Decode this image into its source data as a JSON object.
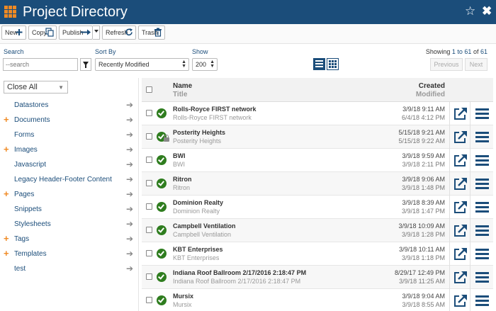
{
  "app": {
    "title": "Project Directory"
  },
  "toolbar": {
    "new_label": "New",
    "copy_label": "Copy",
    "publish_label": "Publish",
    "refresh_label": "Refresh",
    "trash_label": "Trash"
  },
  "filters": {
    "search_label": "Search",
    "search_placeholder": "--search",
    "sort_label": "Sort By",
    "sort_value": "Recently Modified",
    "show_label": "Show",
    "show_value": "200",
    "showing_prefix": "Showing",
    "showing_range": "1 to 61",
    "showing_of": "of",
    "showing_total": "61",
    "previous_label": "Previous",
    "next_label": "Next"
  },
  "sidebar": {
    "close_all_label": "Close All",
    "items": [
      {
        "label": "Datastores",
        "expandable": false
      },
      {
        "label": "Documents",
        "expandable": true
      },
      {
        "label": "Forms",
        "expandable": false
      },
      {
        "label": "Images",
        "expandable": true
      },
      {
        "label": "Javascript",
        "expandable": false
      },
      {
        "label": "Legacy Header-Footer Content",
        "expandable": false
      },
      {
        "label": "Pages",
        "expandable": true
      },
      {
        "label": "Snippets",
        "expandable": false
      },
      {
        "label": "Stylesheets",
        "expandable": false
      },
      {
        "label": "Tags",
        "expandable": true
      },
      {
        "label": "Templates",
        "expandable": true
      },
      {
        "label": "test",
        "expandable": false
      }
    ]
  },
  "table": {
    "headers": {
      "name": "Name",
      "title": "Title",
      "created": "Created",
      "modified": "Modified"
    },
    "rows": [
      {
        "name": "Rolls-Royce FIRST network",
        "title": "Rolls-Royce FIRST network",
        "created": "3/9/18 9:11 AM",
        "modified": "6/4/18 4:12 PM",
        "locked": false
      },
      {
        "name": "Posterity Heights",
        "title": "Posterity Heights",
        "created": "5/15/18 9:21 AM",
        "modified": "5/15/18 9:22 AM",
        "locked": true
      },
      {
        "name": "BWI",
        "title": "BWI",
        "created": "3/9/18 9:59 AM",
        "modified": "3/9/18 2:11 PM",
        "locked": false
      },
      {
        "name": "Ritron",
        "title": "Ritron",
        "created": "3/9/18 9:06 AM",
        "modified": "3/9/18 1:48 PM",
        "locked": false
      },
      {
        "name": "Dominion Realty",
        "title": "Dominion Realty",
        "created": "3/9/18 8:39 AM",
        "modified": "3/9/18 1:47 PM",
        "locked": false
      },
      {
        "name": "Campbell Ventilation",
        "title": "Campbell Ventilation",
        "created": "3/9/18 10:09 AM",
        "modified": "3/9/18 1:28 PM",
        "locked": false
      },
      {
        "name": "KBT Enterprises",
        "title": "KBT Enterprises",
        "created": "3/9/18 10:11 AM",
        "modified": "3/9/18 1:18 PM",
        "locked": false
      },
      {
        "name": "Indiana Roof Ballroom 2/17/2016 2:18:47 PM",
        "title": "Indiana Roof Ballroom 2/17/2016 2:18:47 PM",
        "created": "8/29/17 12:49 PM",
        "modified": "3/9/18 11:25 AM",
        "locked": false
      },
      {
        "name": "Mursix",
        "title": "Mursix",
        "created": "3/9/18 9:04 AM",
        "modified": "3/9/18 8:55 AM",
        "locked": false
      }
    ]
  },
  "colors": {
    "header_bg": "#1b4d7a",
    "accent": "#f08a24",
    "status_ok": "#2f7d1f"
  },
  "icons": {
    "app": "grid-icon",
    "favorite": "star-icon",
    "close": "close-icon",
    "status": "check-circle-icon",
    "open": "external-link-icon",
    "menu": "list-menu-icon"
  }
}
